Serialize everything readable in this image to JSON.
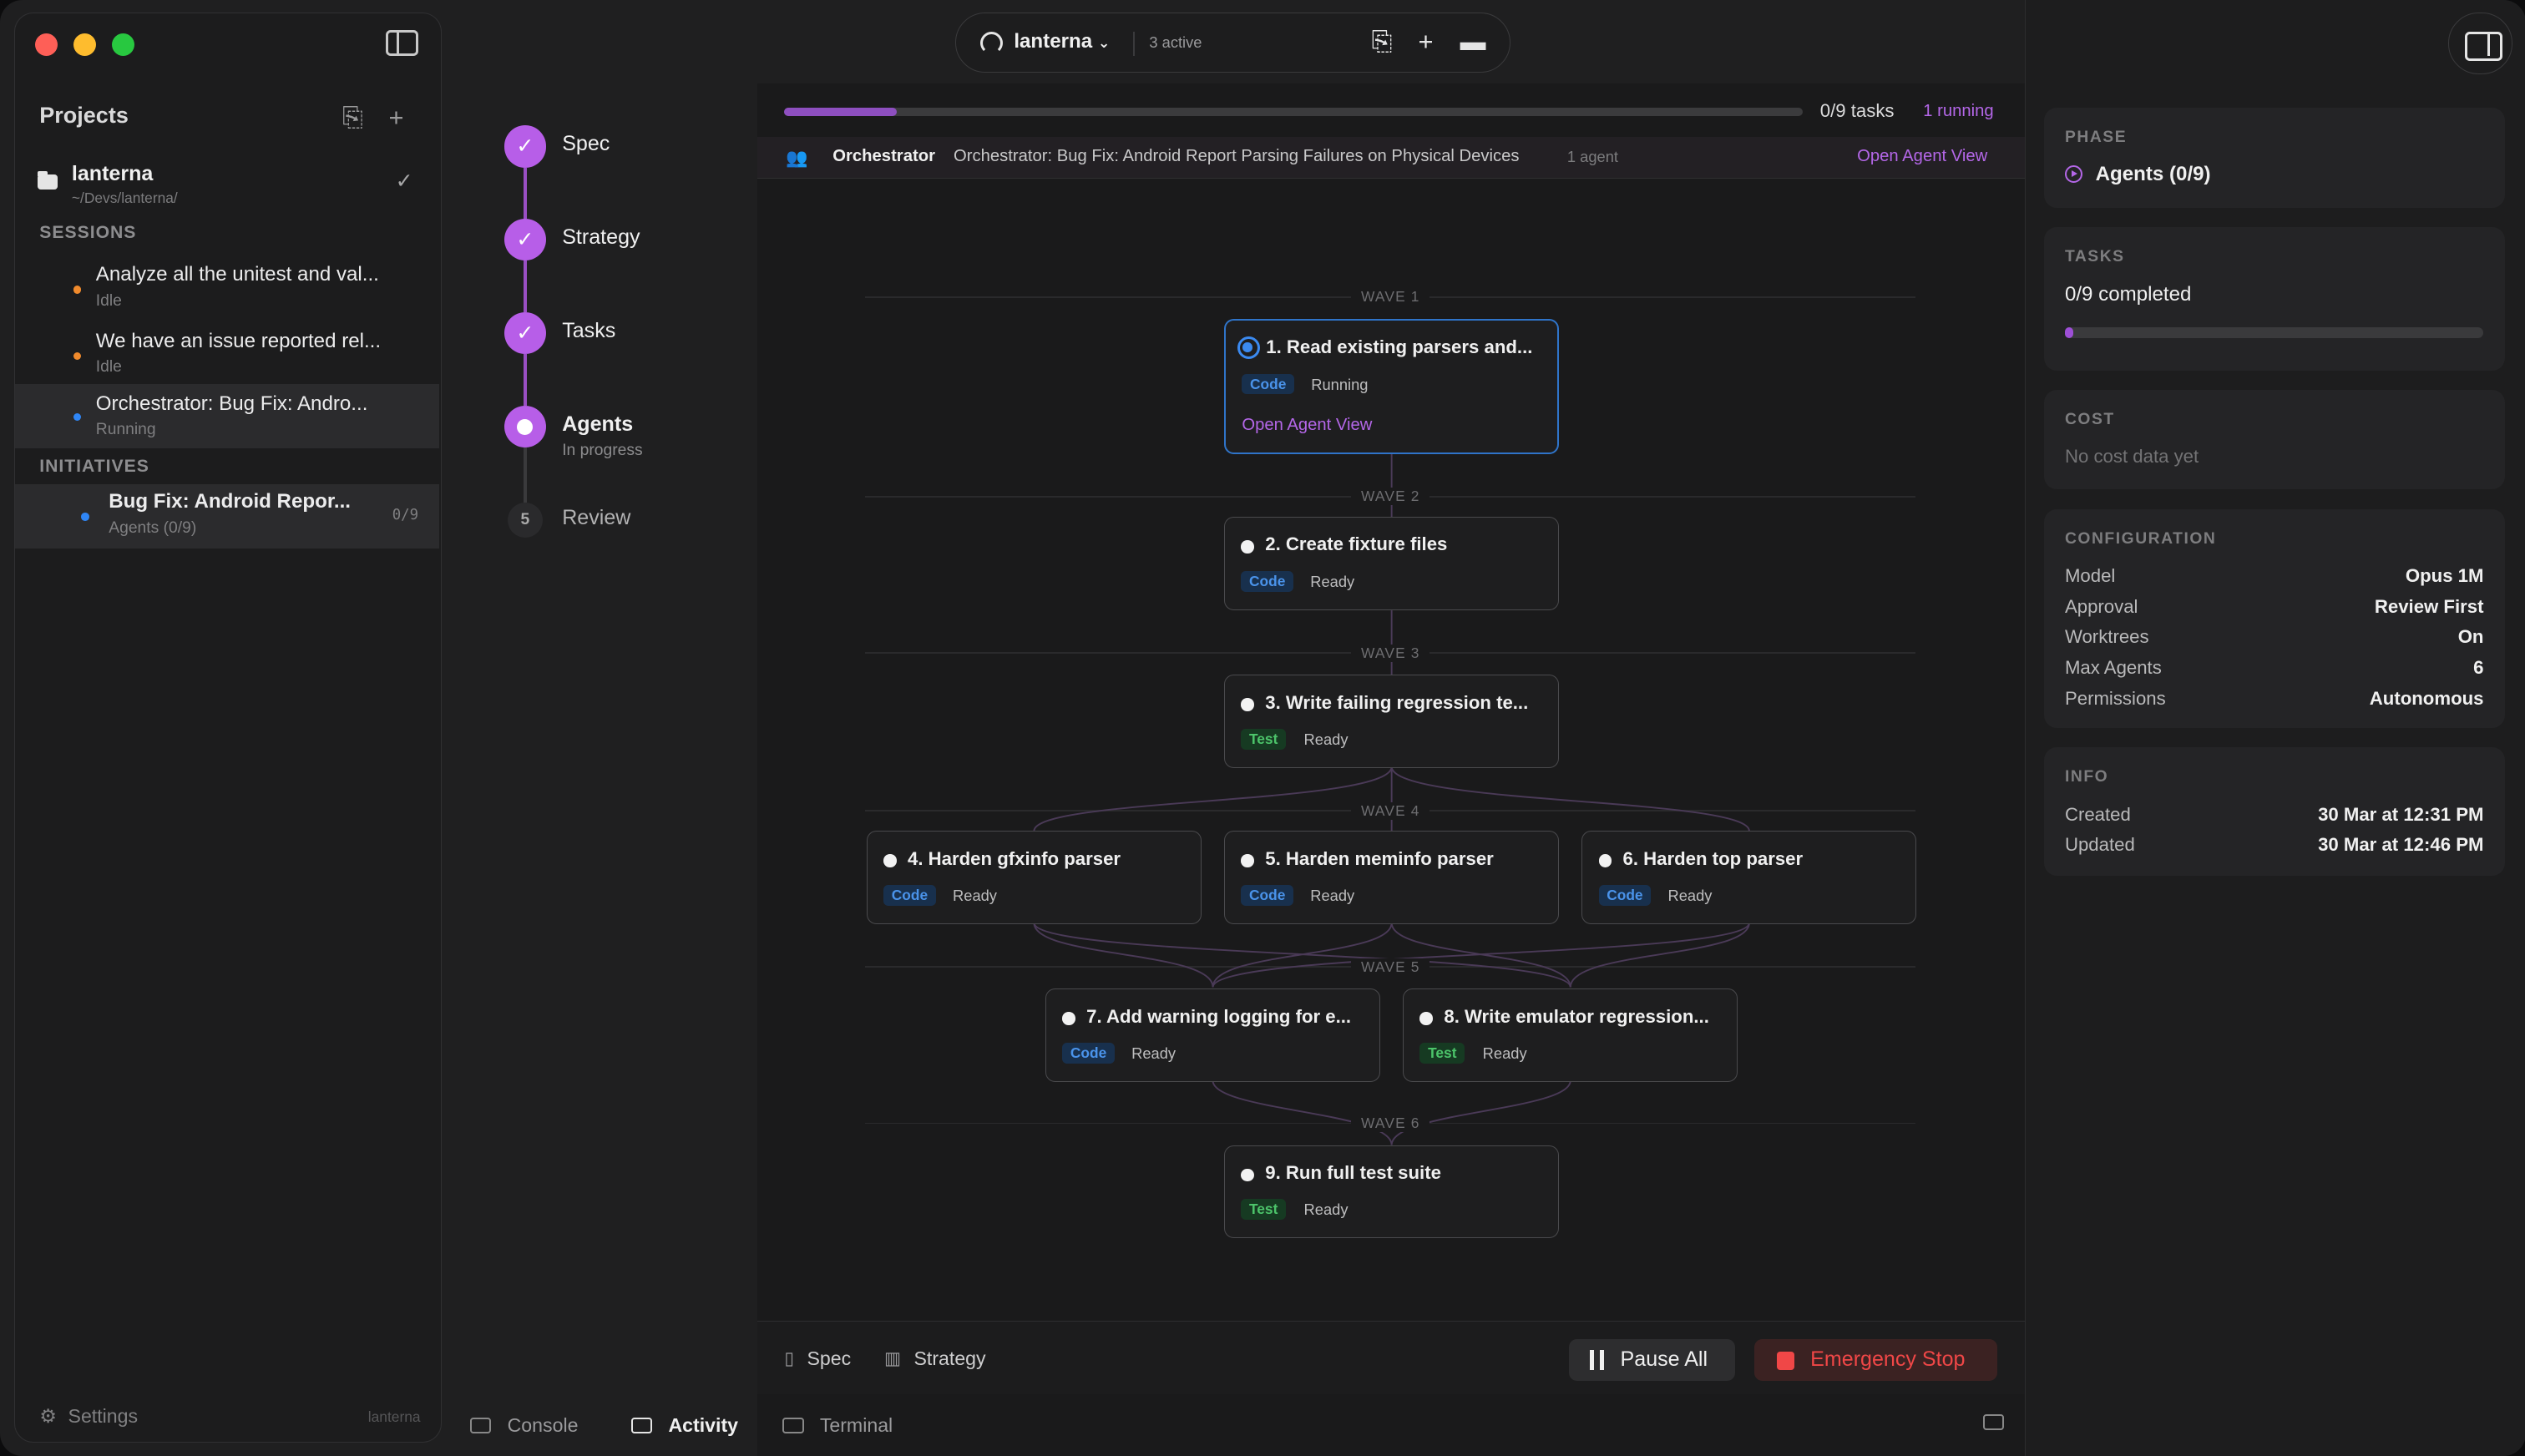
{
  "sidebar": {
    "projects_heading": "Projects",
    "project": {
      "name": "lanterna",
      "path": "~/Devs/lanterna/"
    },
    "sessions_heading": "SESSIONS",
    "sessions": [
      {
        "title": "Analyze all the unitest and val...",
        "status": "Idle",
        "dot_color": "#f08a2c"
      },
      {
        "title": "We have an issue reported rel...",
        "status": "Idle",
        "dot_color": "#f08a2c"
      },
      {
        "title": "Orchestrator: Bug Fix: Andro...",
        "status": "Running",
        "dot_color": "#2f86f6"
      }
    ],
    "initiatives_heading": "INITIATIVES",
    "initiative": {
      "title": "Bug Fix: Android Repor...",
      "sub": "Agents (0/9)",
      "count": "0/9"
    },
    "settings_label": "Settings",
    "footer_project": "lanterna"
  },
  "steps": [
    {
      "label": "Spec",
      "state": "done"
    },
    {
      "label": "Strategy",
      "state": "done"
    },
    {
      "label": "Tasks",
      "state": "done"
    },
    {
      "label": "Agents",
      "sub": "In progress",
      "state": "current"
    },
    {
      "number": "5",
      "label": "Review",
      "state": "pending"
    }
  ],
  "topbar": {
    "project": "lanterna",
    "active": "3 active"
  },
  "progress": {
    "label": "0/9 tasks",
    "running": "1 running",
    "fraction": 0.11
  },
  "orchestrator": {
    "name": "Orchestrator",
    "title": "Orchestrator: Bug Fix: Android Report Parsing Failures on Physical Devices",
    "agents": "1 agent",
    "open_link": "Open Agent View"
  },
  "waves": [
    "WAVE 1",
    "WAVE 2",
    "WAVE 3",
    "WAVE 4",
    "WAVE 5",
    "WAVE 6"
  ],
  "tasks": [
    {
      "title": "1. Read existing parsers and...",
      "tag": "Code",
      "status": "Running",
      "open": "Open Agent View"
    },
    {
      "title": "2. Create fixture files",
      "tag": "Code",
      "status": "Ready"
    },
    {
      "title": "3. Write failing regression te...",
      "tag": "Test",
      "status": "Ready"
    },
    {
      "title": "4. Harden gfxinfo parser",
      "tag": "Code",
      "status": "Ready"
    },
    {
      "title": "5. Harden meminfo parser",
      "tag": "Code",
      "status": "Ready"
    },
    {
      "title": "6. Harden top parser",
      "tag": "Code",
      "status": "Ready"
    },
    {
      "title": "7. Add warning logging for e...",
      "tag": "Code",
      "status": "Ready"
    },
    {
      "title": "8. Write emulator regression...",
      "tag": "Test",
      "status": "Ready"
    },
    {
      "title": "9. Run full test suite",
      "tag": "Test",
      "status": "Ready"
    }
  ],
  "controls": {
    "spec": "Spec",
    "strategy": "Strategy",
    "pause_all": "Pause All",
    "emergency_stop": "Emergency Stop"
  },
  "bottom_tabs": [
    "Console",
    "Activity",
    "Terminal"
  ],
  "right_panel": {
    "phase": {
      "heading": "PHASE",
      "value": "Agents (0/9)"
    },
    "tasks": {
      "heading": "TASKS",
      "value": "0/9 completed",
      "fraction": 0.0
    },
    "cost": {
      "heading": "COST",
      "value": "No cost data yet"
    },
    "configuration": {
      "heading": "CONFIGURATION",
      "rows": [
        {
          "k": "Model",
          "v": "Opus 1M"
        },
        {
          "k": "Approval",
          "v": "Review First"
        },
        {
          "k": "Worktrees",
          "v": "On"
        },
        {
          "k": "Max Agents",
          "v": "6"
        },
        {
          "k": "Permissions",
          "v": "Autonomous"
        }
      ]
    },
    "info": {
      "heading": "INFO",
      "rows": [
        {
          "k": "Created",
          "v": "30 Mar at 12:31 PM"
        },
        {
          "k": "Updated",
          "v": "30 Mar at 12:46 PM"
        }
      ]
    }
  },
  "colors": {
    "accent": "#b467e8",
    "running_blue": "#2f74c9",
    "stop_red": "#f04747"
  }
}
